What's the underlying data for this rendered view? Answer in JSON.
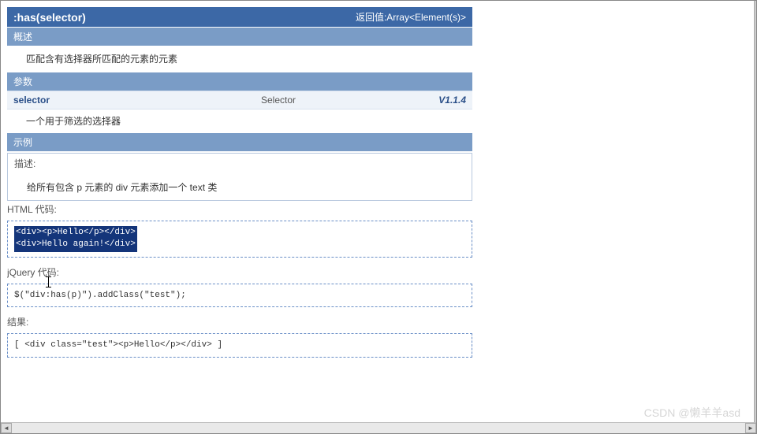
{
  "title_bar": {
    "title": ":has(selector)",
    "return_label": "返回值:Array<Element(s)>"
  },
  "sections": {
    "overview_header": "概述",
    "overview_text": "匹配含有选择器所匹配的元素的元素",
    "params_header": "参数",
    "example_header": "示例"
  },
  "param": {
    "name": "selector",
    "type": "Selector",
    "version": "V1.1.4",
    "desc": "一个用于筛选的选择器"
  },
  "example": {
    "label": "描述:",
    "desc": "给所有包含 p 元素的 div 元素添加一个 text 类",
    "html_label": "HTML 代码:",
    "html_code_line1": "<div><p>Hello</p></div>",
    "html_code_line2": "<div>Hello again!</div>",
    "jquery_label": "jQuery 代码:",
    "jquery_code": "$(\"div:has(p)\").addClass(\"test\");",
    "result_label": "结果:",
    "result_code": "[ <div class=\"test\"><p>Hello</p></div> ]"
  },
  "watermark": "CSDN @懒羊羊asd",
  "scroll": {
    "left_arrow": "◄",
    "right_arrow": "►"
  }
}
